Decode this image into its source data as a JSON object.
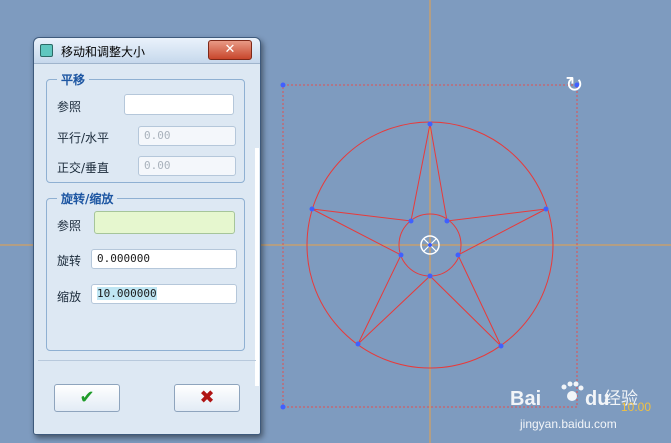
{
  "dialog": {
    "title": "移动和调整大小",
    "close_symbol": "✕",
    "move_group": {
      "title": "平移",
      "reference_label": "参照",
      "reference_value": "",
      "horizontal_label": "平行/水平",
      "horizontal_value": "0.00",
      "vertical_label": "正交/垂直",
      "vertical_value": "0.00"
    },
    "rotate_group": {
      "title": "旋转/缩放",
      "reference_label": "参照",
      "reference_value": "",
      "rotate_label": "旋转",
      "rotate_value": "0.000000",
      "scale_label": "缩放",
      "scale_value": "10.000000"
    },
    "ok_symbol": "✔",
    "cancel_symbol": "✖"
  },
  "canvas": {
    "rotate_handle_symbol": "↻",
    "scale_readout": "10.00",
    "watermark_brand": "Bai",
    "watermark_brand2": "du",
    "watermark_cn": "经验",
    "watermark_url": "jingyan.baidu.com"
  },
  "colors": {
    "background": "#7e9bbf",
    "axis": "#e8a24a",
    "sketch": "#e83a3a",
    "vertex": "#4060ff",
    "bbox": "#e05050"
  }
}
